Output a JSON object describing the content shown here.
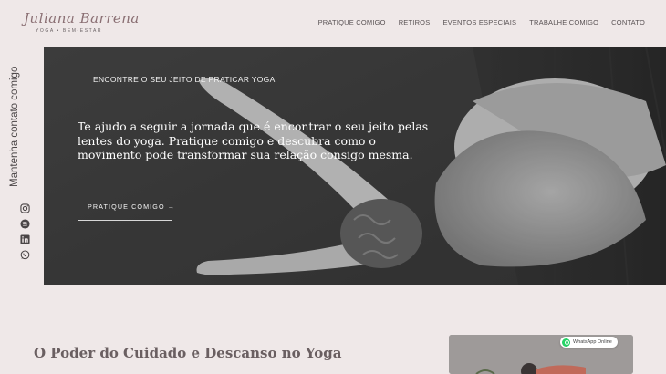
{
  "header": {
    "logo_name": "Juliana Barrena",
    "logo_tagline": "YOGA • BEM-ESTAR",
    "nav": [
      "PRATIQUE COMIGO",
      "RETIROS",
      "EVENTOS ESPECIAIS",
      "TRABALHE COMIGO",
      "CONTATO"
    ]
  },
  "side": {
    "text": "Mantenha contato comigo",
    "social_icons": [
      "instagram-icon",
      "spotify-icon",
      "linkedin-icon",
      "whatsapp-icon"
    ]
  },
  "hero": {
    "kicker": "ENCONTRE O SEU JEITO DE PRATICAR YOGA",
    "body": "Te ajudo a seguir a jornada que é encontrar o seu jeito pelas lentes do yoga. Pratique comigo e descubra como o movimento pode transformar sua relação consigo mesma.",
    "cta": "PRATIQUE COMIGO →"
  },
  "section": {
    "title": "O Poder do Cuidado e Descanso no Yoga"
  },
  "whatsapp_badge": "WhatsApp Online",
  "colors": {
    "background": "#efe8e8",
    "logo": "#8a6f73",
    "whatsapp": "#25d366"
  }
}
